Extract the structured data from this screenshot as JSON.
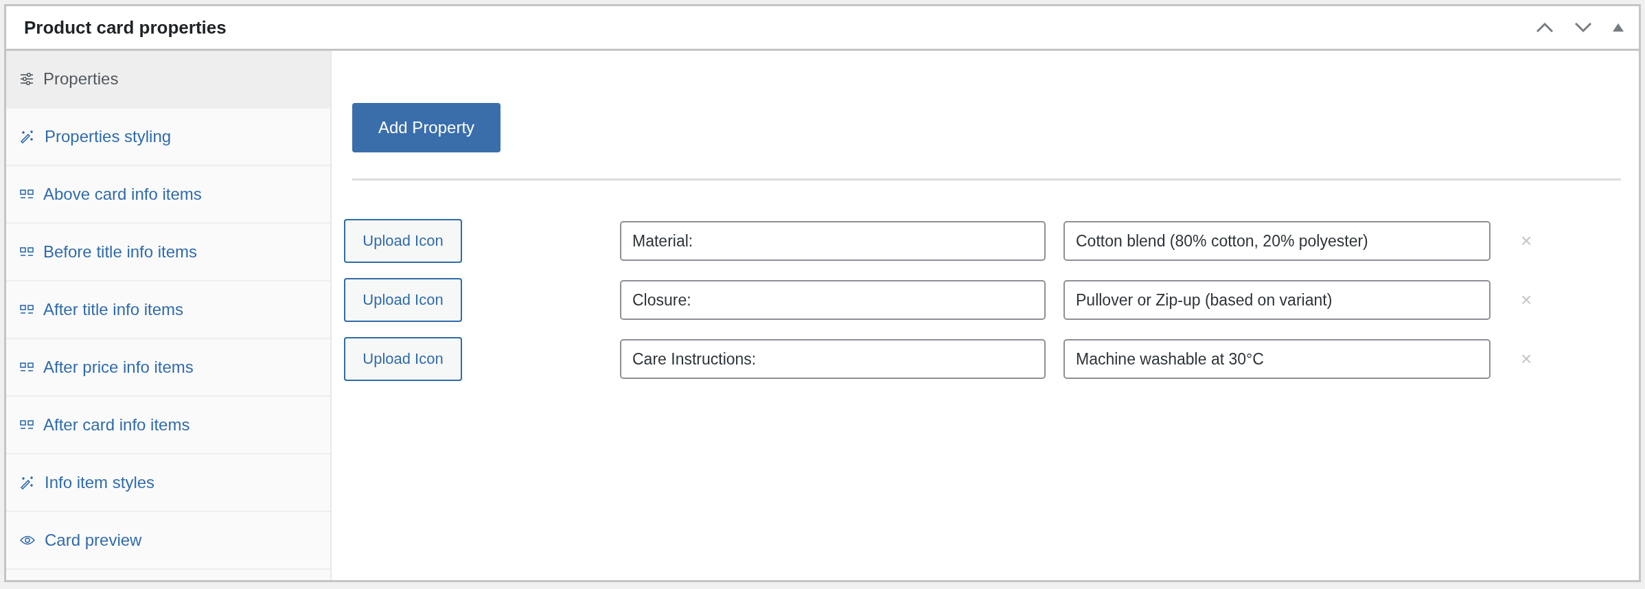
{
  "panel": {
    "title": "Product card properties"
  },
  "sidebar": {
    "items": [
      {
        "label": "Properties",
        "kind": "sliders",
        "selected": true
      },
      {
        "label": "Properties styling",
        "kind": "wand",
        "selected": false
      },
      {
        "label": "Above card info items",
        "kind": "grid",
        "selected": false
      },
      {
        "label": "Before title info items",
        "kind": "grid",
        "selected": false
      },
      {
        "label": "After title info items",
        "kind": "grid",
        "selected": false
      },
      {
        "label": "After price info items",
        "kind": "grid",
        "selected": false
      },
      {
        "label": "After card info items",
        "kind": "grid",
        "selected": false
      },
      {
        "label": "Info item styles",
        "kind": "wand",
        "selected": false
      },
      {
        "label": "Card preview",
        "kind": "eye",
        "selected": false
      }
    ]
  },
  "add_button": "Add Property",
  "properties": [
    {
      "upload": "Upload Icon",
      "label": "Material:",
      "value": "Cotton blend (80% cotton, 20% polyester)",
      "remove": "×"
    },
    {
      "upload": "Upload Icon",
      "label": "Closure:",
      "value": "Pullover or Zip-up (based on variant)",
      "remove": "×"
    },
    {
      "upload": "Upload Icon",
      "label": "Care Instructions:",
      "value": "Machine washable at 30°C",
      "remove": "×"
    }
  ]
}
